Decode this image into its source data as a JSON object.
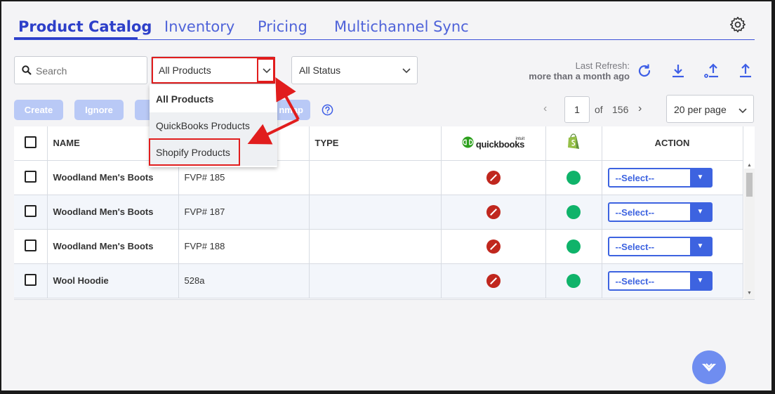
{
  "tabs": [
    {
      "label": "Product Catalog",
      "active": true
    },
    {
      "label": "Inventory",
      "active": false
    },
    {
      "label": "Pricing",
      "active": false
    },
    {
      "label": "Multichannel Sync",
      "active": false
    }
  ],
  "search": {
    "placeholder": "Search"
  },
  "product_filter": {
    "value": "All Products"
  },
  "status_filter": {
    "value": "All Status"
  },
  "refresh": {
    "label": "Last Refresh:",
    "value": "more than a month ago"
  },
  "toolbar": {
    "create": "Create",
    "ignore": "Ignore",
    "partial_label": "nmap"
  },
  "pagination": {
    "current": "1",
    "of": "of",
    "total": "156",
    "per_page": "20 per page"
  },
  "dropdown": {
    "items": [
      "All Products",
      "QuickBooks Products",
      "Shopify Products"
    ],
    "selected": "All Products",
    "highlighted": "Shopify Products"
  },
  "table": {
    "headers": {
      "name": "NAME",
      "type": "TYPE",
      "action": "ACTION",
      "qb_logo_text": "quickbooks",
      "qb_logo_small": "intuit"
    },
    "rows": [
      {
        "name": "Woodland Men's Boots",
        "sku": "FVP# 185",
        "type": "",
        "qb_status": "not-synced",
        "shopify_status": "synced",
        "action": "--Select--"
      },
      {
        "name": "Woodland Men's Boots",
        "sku": "FVP# 187",
        "type": "",
        "qb_status": "not-synced",
        "shopify_status": "synced",
        "action": "--Select--"
      },
      {
        "name": "Woodland Men's Boots",
        "sku": "FVP# 188",
        "type": "",
        "qb_status": "not-synced",
        "shopify_status": "synced",
        "action": "--Select--"
      },
      {
        "name": "Wool Hoodie",
        "sku": "528a",
        "type": "",
        "qb_status": "not-synced",
        "shopify_status": "synced",
        "action": "--Select--"
      }
    ]
  },
  "colors": {
    "accent": "#2d3fc9",
    "annotation": "#e11d1d",
    "not_synced": "#c0271e",
    "synced": "#0fb36a",
    "action_blue": "#3d63e0"
  }
}
